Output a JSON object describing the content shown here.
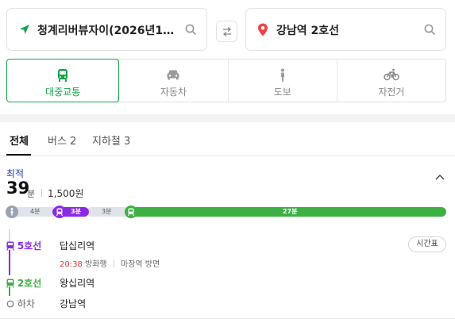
{
  "search": {
    "origin": "청계리버뷰자이(2026년12월입주예정)",
    "destination": "강남역 2호선"
  },
  "modes": [
    {
      "label": "대중교통",
      "icon": "bus-icon",
      "active": true
    },
    {
      "label": "자동차",
      "icon": "car-icon",
      "active": false
    },
    {
      "label": "도보",
      "icon": "walk-icon",
      "active": false
    },
    {
      "label": "자전거",
      "icon": "bicycle-icon",
      "active": false
    }
  ],
  "tabs": [
    {
      "label": "전체",
      "active": true
    },
    {
      "label": "버스 2",
      "active": false
    },
    {
      "label": "지하철 3",
      "active": false
    }
  ],
  "route": {
    "badge": "최적",
    "minutes": "39",
    "minutes_unit": "분",
    "fare": "1,500원",
    "timeline": {
      "walk": "4분",
      "line5": "3분",
      "wait": "3분",
      "line2": "27분"
    },
    "steps": [
      {
        "line": "5호선",
        "station": "답십리역"
      },
      {
        "line": "2호선",
        "station": "왕십리역"
      },
      {
        "line": "하차",
        "station": "강남역"
      }
    ],
    "schedule_button": "시간표",
    "departure_time": "20:38",
    "direction": "방화행",
    "platform": "마장역 방면"
  },
  "colors": {
    "accent": "#16a34a",
    "line5": "#8a2be2",
    "line2": "#3cb043",
    "badge": "#1b3fa8",
    "time_red": "#e53935"
  }
}
